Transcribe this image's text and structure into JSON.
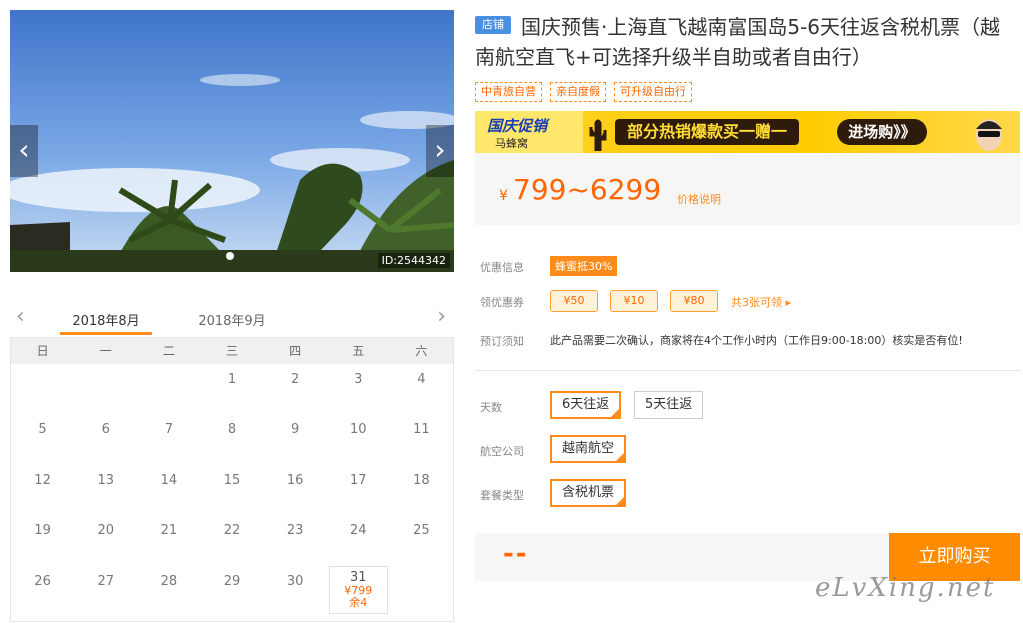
{
  "photo": {
    "id_label": "ID:2544342",
    "prev": "‹",
    "next": "›"
  },
  "calendar": {
    "prev": "‹",
    "next": "›",
    "months": [
      "2018年8月",
      "2018年9月"
    ],
    "weekdays": [
      "日",
      "一",
      "二",
      "三",
      "四",
      "五",
      "六"
    ],
    "cells": [
      "",
      "",
      "",
      "1",
      "2",
      "3",
      "4",
      "5",
      "6",
      "7",
      "8",
      "9",
      "10",
      "11",
      "12",
      "13",
      "14",
      "15",
      "16",
      "17",
      "18",
      "19",
      "20",
      "21",
      "22",
      "23",
      "24",
      "25",
      "26",
      "27",
      "28",
      "29",
      "30",
      "31",
      ""
    ],
    "available": {
      "day": "31",
      "price": "¥799",
      "stock": "余4"
    }
  },
  "product": {
    "shop_badge": "店铺",
    "title": "国庆预售·上海直飞越南富国岛5-6天往返含税机票（越南航空直飞+可选择升级半自助或者自由行）",
    "tags": [
      "中青旅自营",
      "亲自度假",
      "可升级自由行"
    ]
  },
  "banner": {
    "logo_line1": "国庆促销",
    "logo_line2": "马蜂窝",
    "main": "部分热销爆款买一赠一",
    "go": "进场购》》"
  },
  "price": {
    "yen": "¥",
    "range": "799~6299",
    "explain": "价格说明"
  },
  "info": {
    "discount_label": "优惠信息",
    "discount_value": "蜂蜜抵30%",
    "coupon_label": "领优惠券",
    "coupons": [
      "¥50",
      "¥10",
      "¥80"
    ],
    "coupon_more": "共3张可领 ▸",
    "notice_label": "预订须知",
    "notice_text": "此产品需要二次确认，商家将在4个工作小时内（工作日9:00-18:00）核实是否有位!"
  },
  "options": {
    "days_label": "天数",
    "days": [
      "6天往返",
      "5天往返"
    ],
    "airline_label": "航空公司",
    "airline": "越南航空",
    "package_label": "套餐类型",
    "package": "含税机票"
  },
  "buy": {
    "price_placeholder": "--",
    "button": "立即购买"
  },
  "watermark": "eLvXing.net",
  "colors": {
    "accent": "#ff8c1a",
    "price": "#ff6600",
    "badge": "#4a90e2"
  }
}
